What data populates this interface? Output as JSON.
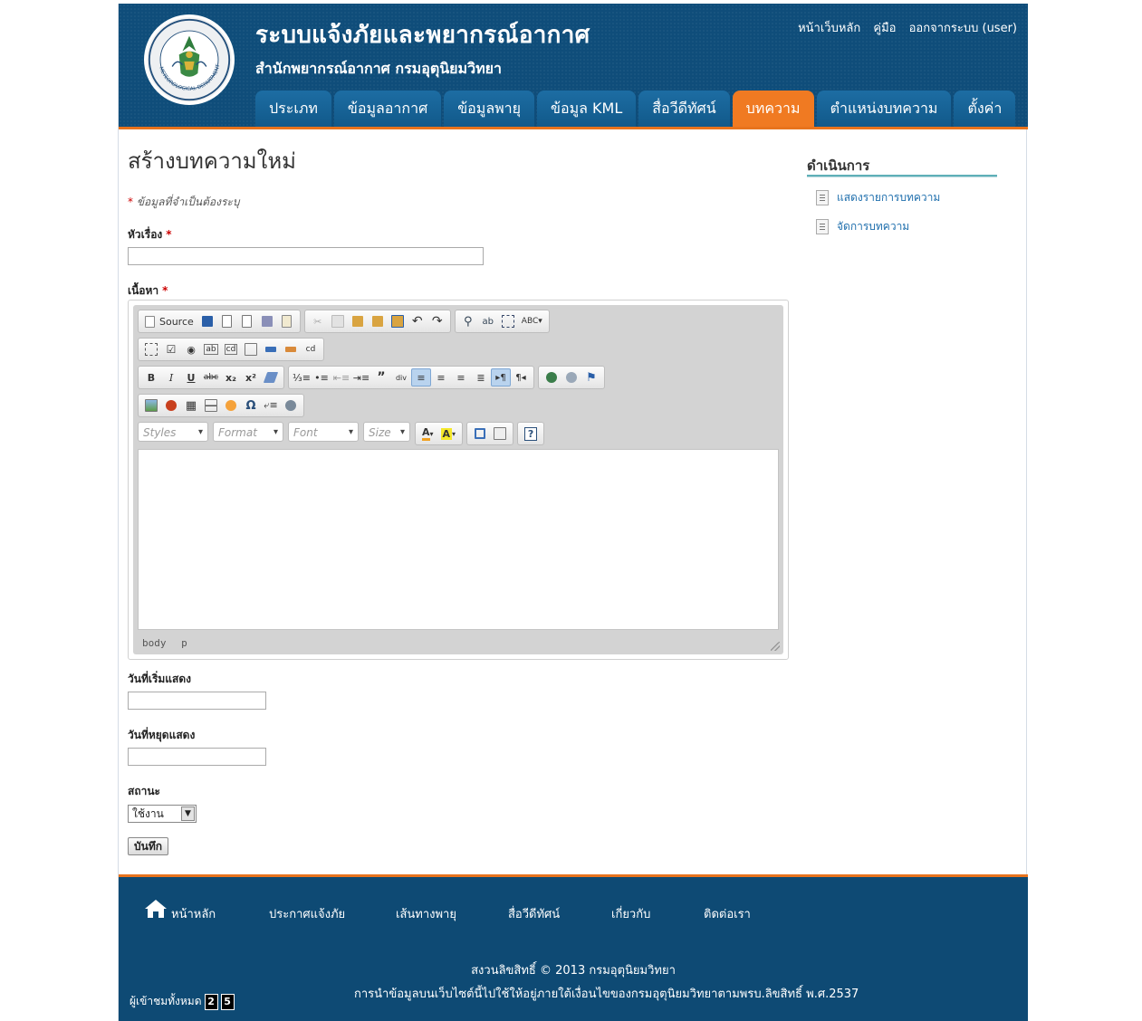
{
  "header": {
    "title": "ระบบแจ้งภัยและพยากรณ์อากาศ",
    "subtitle": "สำนักพยากรณ์อากาศ กรมอุตุนิยมวิทยา",
    "top_links": [
      "หน้าเว็บหลัก",
      "คู่มือ",
      "ออกจากระบบ (user)"
    ],
    "tabs": [
      {
        "label": "ประเภท",
        "active": false
      },
      {
        "label": "ข้อมูลอากาศ",
        "active": false
      },
      {
        "label": "ข้อมูลพายุ",
        "active": false
      },
      {
        "label": "ข้อมูล KML",
        "active": false
      },
      {
        "label": "สื่อวีดีทัศน์",
        "active": false
      },
      {
        "label": "บทความ",
        "active": true
      },
      {
        "label": "ตำแหน่งบทความ",
        "active": false
      },
      {
        "label": "ตั้งค่า",
        "active": false
      }
    ],
    "accent": "#f07a22",
    "header_bg": "#0f4d7a",
    "logo_text": "METEOROLOGICAL DEPARTMENT"
  },
  "form": {
    "page_title": "สร้างบทความใหม่",
    "required_note": "ข้อมูลที่จำเป็นต้องระบุ",
    "required_mark": "*",
    "title_label": "หัวเรื่อง",
    "title_value": "",
    "content_label": "เนื้อหา",
    "start_label": "วันที่เริ่มแสดง",
    "start_value": "",
    "stop_label": "วันที่หยุดแสดง",
    "stop_value": "",
    "status_label": "สถานะ",
    "status_selected": "ใช้งาน",
    "save_label": "บันทึก"
  },
  "editor": {
    "source_label": "Source",
    "combos": [
      "Styles",
      "Format",
      "Font",
      "Size"
    ],
    "bold": "B",
    "italic": "I",
    "underline": "U",
    "strike": "abc",
    "subscript": "x₂",
    "superscript": "x²",
    "status_path": [
      "body",
      "p"
    ]
  },
  "sidebar": {
    "title": "ดำเนินการ",
    "links": [
      "แสดงรายการบทความ",
      "จัดการบทความ"
    ]
  },
  "footer": {
    "nav": [
      "หน้าหลัก",
      "ประกาศแจ้งภัย",
      "เส้นทางพายุ",
      "สื่อวีดีทัศน์",
      "เกี่ยวกับ",
      "ติดต่อเรา"
    ],
    "copyright": "สงวนลิขสิทธิ์ © 2013 กรมอุตุนิยมวิทยา",
    "license": "การนำข้อมูลบนเว็บไซต์นี้ไปใช้ให้อยู่ภายใต้เงื่อนไขของกรมอุตุนิยมวิทยาตามพรบ.ลิขสิทธิ์ พ.ศ.2537",
    "visits_label": "ผู้เข้าชมทั้งหมด",
    "visit_digits": [
      "2",
      "5"
    ]
  }
}
